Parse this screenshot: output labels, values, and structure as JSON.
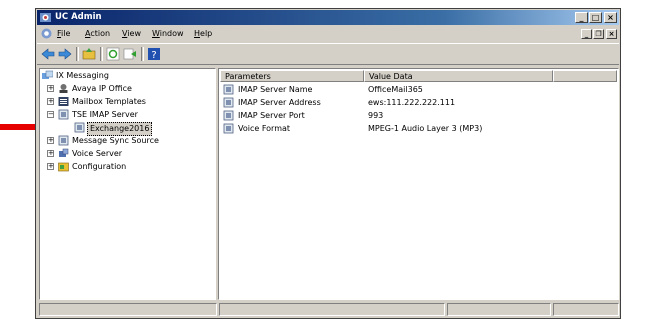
{
  "window": {
    "title": "UC Admin"
  },
  "caption_buttons": {
    "minimize": "_",
    "maximize": "□",
    "close": "×"
  },
  "mdi_buttons": {
    "minimize": "_",
    "restore": "❐",
    "close": "×"
  },
  "menu": [
    {
      "label": "File",
      "accel": "F"
    },
    {
      "label": "Action",
      "accel": "A"
    },
    {
      "label": "View",
      "accel": "V"
    },
    {
      "label": "Window",
      "accel": "W"
    },
    {
      "label": "Help",
      "accel": "H"
    }
  ],
  "tree": {
    "root": "IX Messaging",
    "items": [
      {
        "label": "Avaya IP Office",
        "expander": "+"
      },
      {
        "label": "Mailbox Templates",
        "expander": "+"
      },
      {
        "label": "TSE IMAP Server",
        "expander": "−"
      },
      {
        "label": "Exchange2016"
      },
      {
        "label": "Message Sync Source",
        "expander": "+"
      },
      {
        "label": "Voice Server",
        "expander": "+"
      },
      {
        "label": "Configuration",
        "expander": "+"
      }
    ]
  },
  "list": {
    "columns": [
      "Parameters",
      "Value Data"
    ],
    "rows": [
      {
        "name": "IMAP Server Name",
        "value": "OfficeMail365"
      },
      {
        "name": "IMAP Server Address",
        "value": "ews:111.222.222.111"
      },
      {
        "name": "IMAP Server Port",
        "value": "993"
      },
      {
        "name": "Voice Format",
        "value": "MPEG-1 Audio Layer 3 (MP3)"
      }
    ]
  },
  "colors": {
    "title_start": "#0a246a",
    "title_end": "#a6caf0",
    "face": "#d4d0c8",
    "annotation_arrow": "#e60000"
  }
}
